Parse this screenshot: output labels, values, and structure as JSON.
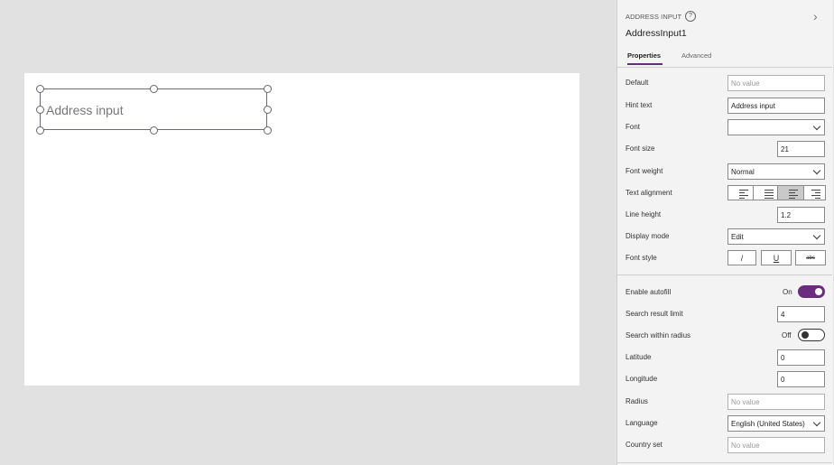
{
  "canvas": {
    "control_hint": "Address input"
  },
  "panel": {
    "control_type": "ADDRESS INPUT",
    "control_name": "AddressInput1",
    "tabs": [
      "Properties",
      "Advanced"
    ],
    "properties": {
      "default": {
        "label": "Default",
        "placeholder": "No value"
      },
      "hint_text": {
        "label": "Hint text",
        "value": "Address input"
      },
      "font": {
        "label": "Font",
        "value": ""
      },
      "font_size": {
        "label": "Font size",
        "value": "21"
      },
      "font_weight": {
        "label": "Font weight",
        "value": "Normal"
      },
      "text_alignment": {
        "label": "Text alignment"
      },
      "line_height": {
        "label": "Line height",
        "value": "1.2"
      },
      "display_mode": {
        "label": "Display mode",
        "value": "Edit"
      },
      "font_style": {
        "label": "Font style",
        "italic": "/",
        "underline": "U",
        "strike": "abc"
      },
      "enable_autofill": {
        "label": "Enable autofill",
        "state": "On"
      },
      "search_result_limit": {
        "label": "Search result limit",
        "value": "4"
      },
      "search_within_radius": {
        "label": "Search within radius",
        "state": "Off"
      },
      "latitude": {
        "label": "Latitude",
        "value": "0"
      },
      "longitude": {
        "label": "Longitude",
        "value": "0"
      },
      "radius": {
        "label": "Radius",
        "placeholder": "No value"
      },
      "language": {
        "label": "Language",
        "value": "English (United States)"
      },
      "country_set": {
        "label": "Country set",
        "placeholder": "No value"
      }
    }
  },
  "colors": {
    "accent": "#6a2c7e"
  }
}
